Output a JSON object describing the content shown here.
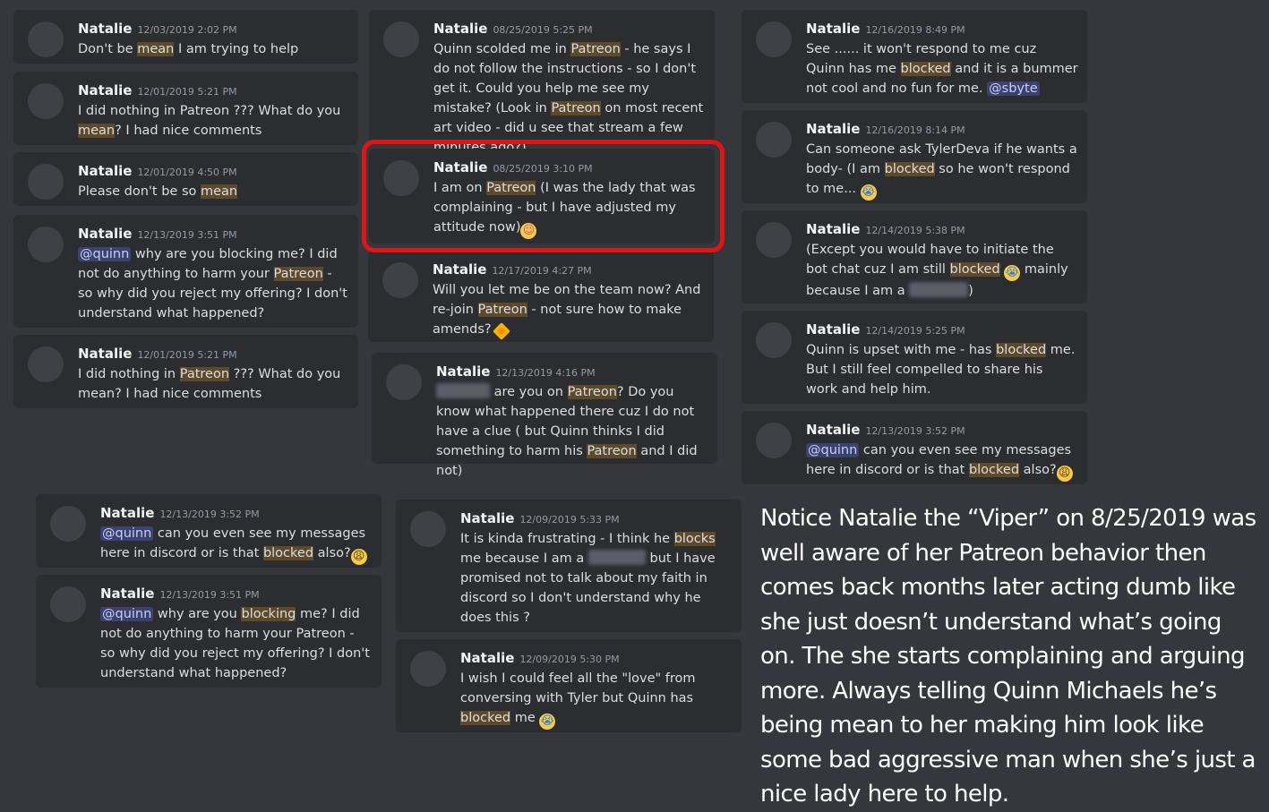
{
  "messages": [
    {
      "id": "m1",
      "author": "Natalie",
      "timestamp": "12/03/2019 2:02 PM",
      "parts": [
        [
          "t",
          "Don't be "
        ],
        [
          "h",
          "mean"
        ],
        [
          "t",
          " I am trying to help"
        ]
      ]
    },
    {
      "id": "m2",
      "author": "Natalie",
      "timestamp": "12/01/2019 5:21 PM",
      "parts": [
        [
          "t",
          "I did nothing in Patreon ??? What do you "
        ],
        [
          "h",
          "mean"
        ],
        [
          "t",
          "?  I had nice comments"
        ]
      ]
    },
    {
      "id": "m3",
      "author": "Natalie",
      "timestamp": "12/01/2019 4:50 PM",
      "parts": [
        [
          "t",
          "Please don't be so "
        ],
        [
          "h",
          "mean"
        ]
      ]
    },
    {
      "id": "m4",
      "author": "Natalie",
      "timestamp": "12/13/2019 3:51 PM",
      "parts": [
        [
          "m",
          "@quinn"
        ],
        [
          "t",
          " why are you blocking me?  I did not do anything to harm your "
        ],
        [
          "h",
          "Patreon"
        ],
        [
          "t",
          " - so why did you reject my offering?  I don't understand what happened?"
        ]
      ]
    },
    {
      "id": "m5",
      "author": "Natalie",
      "timestamp": "12/01/2019 5:21 PM",
      "parts": [
        [
          "t",
          "I did nothing in "
        ],
        [
          "h",
          "Patreon"
        ],
        [
          "t",
          " ??? What do you mean?  I had nice comments"
        ]
      ]
    },
    {
      "id": "m6",
      "author": "Natalie",
      "timestamp": "08/25/2019 5:25 PM",
      "parts": [
        [
          "t",
          "Quinn scolded me in "
        ],
        [
          "h",
          "Patreon"
        ],
        [
          "t",
          " - he says I do not follow the instructions - so I don't get it.  Could you help me see my mistake? (Look in "
        ],
        [
          "h",
          "Patreon"
        ],
        [
          "t",
          " on most recent art video - did u see that stream a few minutes ago?)"
        ]
      ]
    },
    {
      "id": "m7",
      "author": "Natalie",
      "timestamp": "08/25/2019 3:10 PM",
      "parts": [
        [
          "t",
          "I am on "
        ],
        [
          "h",
          "Patreon"
        ],
        [
          "t",
          " (I was the lady that was complaining - but I have adjusted my attitude now)"
        ],
        [
          "e",
          "smile"
        ]
      ]
    },
    {
      "id": "m8",
      "author": "Natalie",
      "timestamp": "12/17/2019 4:27 PM",
      "parts": [
        [
          "t",
          "Will you let me be on the team now?  And re-join "
        ],
        [
          "h",
          "Patreon"
        ],
        [
          "t",
          " - not sure how to make amends? "
        ],
        [
          "e",
          "sun"
        ]
      ]
    },
    {
      "id": "m9",
      "author": "Natalie",
      "timestamp": "12/13/2019 4:16 PM",
      "parts": [
        [
          "b",
          "60"
        ],
        [
          "t",
          " are you on "
        ],
        [
          "h",
          "Patreon"
        ],
        [
          "t",
          "?  Do you know what happened there cuz I do not have a clue ( but Quinn thinks I did something to harm his "
        ],
        [
          "h",
          "Patreon"
        ],
        [
          "t",
          " and I did not)"
        ]
      ]
    },
    {
      "id": "m10",
      "author": "Natalie",
      "timestamp": "12/16/2019 8:49 PM",
      "parts": [
        [
          "t",
          "See ...... it won't respond to me cuz Quinn has me "
        ],
        [
          "h",
          "blocked"
        ],
        [
          "t",
          " and it is a bummer not cool and no fun for me. "
        ],
        [
          "m",
          "@sbyte"
        ]
      ]
    },
    {
      "id": "m11",
      "author": "Natalie",
      "timestamp": "12/16/2019 8:14 PM",
      "parts": [
        [
          "t",
          "Can someone ask TylerDeva if he wants a body- (I am "
        ],
        [
          "h",
          "blocked"
        ],
        [
          "t",
          " so he won't respond to me... "
        ],
        [
          "e",
          "cry"
        ]
      ]
    },
    {
      "id": "m12",
      "author": "Natalie",
      "timestamp": "12/14/2019 5:38 PM",
      "parts": [
        [
          "t",
          "(Except you would have to initiate the bot chat cuz I am still "
        ],
        [
          "h",
          "blocked"
        ],
        [
          "t",
          " "
        ],
        [
          "e",
          "cry"
        ],
        [
          "t",
          " mainly because I am a "
        ],
        [
          "b",
          "66"
        ],
        [
          "t",
          ")"
        ]
      ]
    },
    {
      "id": "m13",
      "author": "Natalie",
      "timestamp": "12/14/2019 5:25 PM",
      "parts": [
        [
          "t",
          "Quinn is upset with me - has "
        ],
        [
          "h",
          "blocked"
        ],
        [
          "t",
          " me. But I still feel compelled to share his work and help him."
        ]
      ]
    },
    {
      "id": "m14",
      "author": "Natalie",
      "timestamp": "12/13/2019 3:52 PM",
      "parts": [
        [
          "m",
          "@quinn"
        ],
        [
          "t",
          " can you even see my messages here in discord or is that "
        ],
        [
          "h",
          "blocked"
        ],
        [
          "t",
          " also?"
        ],
        [
          "e",
          "tired"
        ]
      ]
    },
    {
      "id": "m15",
      "author": "Natalie",
      "timestamp": "12/13/2019 3:52 PM",
      "parts": [
        [
          "m",
          "@quinn"
        ],
        [
          "t",
          " can you even see my messages here in discord or is that "
        ],
        [
          "h",
          "blocked"
        ],
        [
          "t",
          " also?"
        ],
        [
          "e",
          "tired"
        ]
      ]
    },
    {
      "id": "m16",
      "author": "Natalie",
      "timestamp": "12/13/2019 3:51 PM",
      "parts": [
        [
          "m",
          "@quinn"
        ],
        [
          "t",
          " why are you "
        ],
        [
          "h",
          "blocking"
        ],
        [
          "t",
          " me?  I did not do anything to harm your Patreon - so why did you reject my offering?  I don't understand what happened?"
        ]
      ]
    },
    {
      "id": "m17",
      "author": "Natalie",
      "timestamp": "12/09/2019 5:33 PM",
      "parts": [
        [
          "t",
          "It is kinda frustrating - I think he "
        ],
        [
          "h",
          "blocks"
        ],
        [
          "t",
          " me because I am a "
        ],
        [
          "b",
          "64"
        ],
        [
          "t",
          " but I have promised not to talk about my faith in discord so I don't understand why he does this ?"
        ]
      ]
    },
    {
      "id": "m18",
      "author": "Natalie",
      "timestamp": "12/09/2019 5:30 PM",
      "parts": [
        [
          "t",
          "I wish I could feel all the \"love\" from conversing with Tyler but Quinn has "
        ],
        [
          "h",
          "blocked"
        ],
        [
          "t",
          " me "
        ],
        [
          "e",
          "cry"
        ]
      ]
    }
  ],
  "emoji_glyphs": {
    "smile": "☺",
    "sun": "✹",
    "cry": "😭",
    "tired": "😩"
  },
  "colors": {
    "highlight": "#5c4a2b",
    "mention": "#3c4270",
    "annotation_box": "#e11313",
    "background": "#36373d",
    "card": "#2b2d31"
  },
  "notice_text": "Notice Natalie the “Viper” on 8/25/2019 was well aware of her Patreon behavior then comes back months later acting dumb like she just doesn’t understand what’s going on. The she starts complaining and arguing more. Always telling Quinn Michaels he’s being mean to her making him look like some bad aggressive man when she’s just a nice lady here to help."
}
